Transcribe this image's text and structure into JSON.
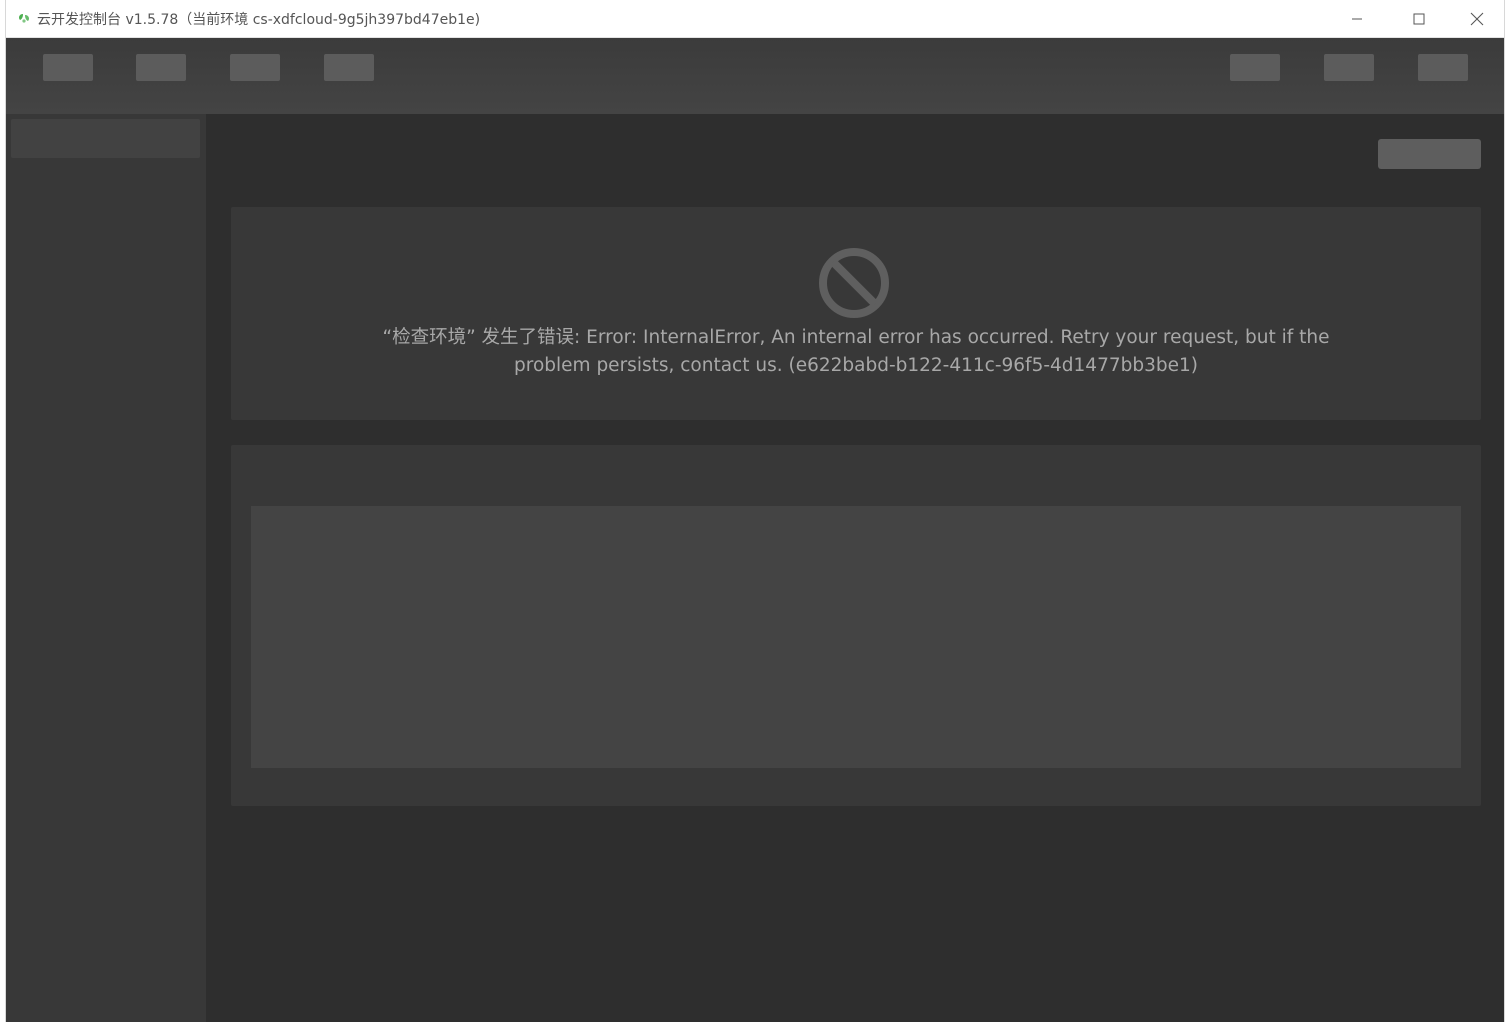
{
  "window": {
    "title": "云开发控制台 v1.5.78（当前环境 cs-xdfcloud-9g5jh397bd47eb1e)",
    "icon": "cloud-leaf-icon",
    "controls": [
      "minimize-icon",
      "maximize-icon",
      "close-icon"
    ]
  },
  "error": {
    "icon": "prohibited-icon",
    "message": "“检查环境” 发生了错误: Error: InternalError, An internal error has occurred. Retry your request, but if the problem persists, contact us. (e622babd-b122-411c-96f5-4d1477bb3be1)"
  },
  "colors": {
    "background": "#2e2e2e",
    "panel": "#383838",
    "placeholder": "#5c5c5c",
    "text": "#a8a8a8"
  }
}
